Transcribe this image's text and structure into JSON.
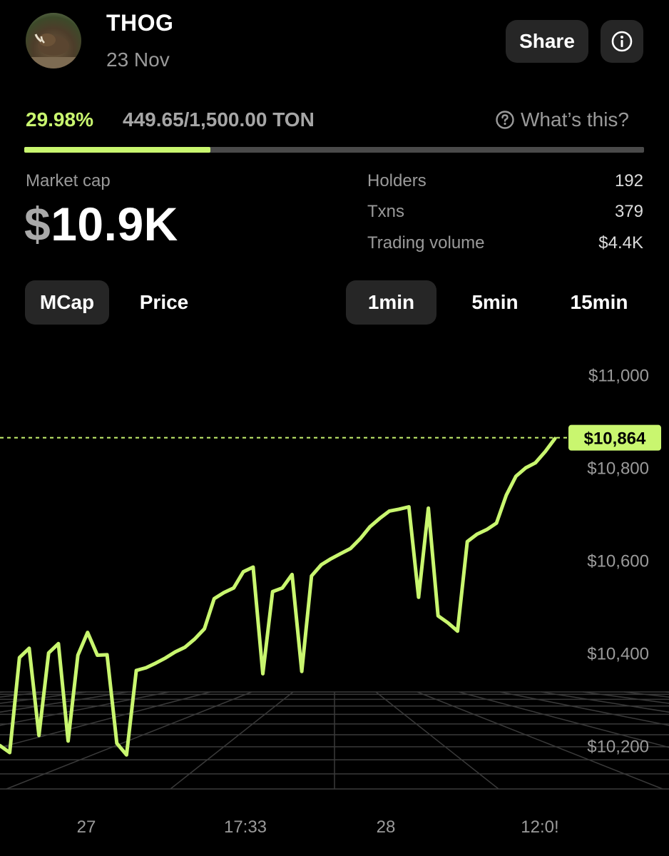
{
  "header": {
    "token_name": "THOG",
    "date": "23 Nov",
    "share_label": "Share",
    "info_icon": "info-icon",
    "avatar": "warthog-avatar"
  },
  "progress": {
    "percent_label": "29.98%",
    "amount_label": "449.65/1,500.00 TON",
    "fraction": 0.2998,
    "whats_this_label": "What’s this?",
    "help_icon": "question-circle-icon"
  },
  "stats": {
    "market_cap_label": "Market cap",
    "market_cap_currency": "$",
    "market_cap_value": "10.9K",
    "rows": [
      {
        "label": "Holders",
        "value": "192"
      },
      {
        "label": "Txns",
        "value": "379"
      },
      {
        "label": "Trading volume",
        "value": "$4.4K"
      }
    ]
  },
  "toggles": {
    "metric": [
      "MCap",
      "Price"
    ],
    "metric_selected": "MCap",
    "interval": [
      "1min",
      "5min",
      "15min"
    ],
    "interval_selected": "1min"
  },
  "colors": {
    "accent": "#c9f66f",
    "background": "#000000",
    "button_bg": "#262626",
    "muted_text": "#9a9a9a"
  },
  "chart_data": {
    "type": "line",
    "y_ticks": [
      "$11,000",
      "$10,800",
      "$10,600",
      "$10,400",
      "$10,200"
    ],
    "y_tick_values": [
      11000,
      10800,
      10600,
      10400,
      10200
    ],
    "ylim": [
      10085,
      11085
    ],
    "x_ticks": [
      "27",
      "17:33",
      "28",
      "12:0!"
    ],
    "current_value": 10864,
    "current_label": "$10,864",
    "series": [
      {
        "values": [
          10200,
          10185,
          10390,
          10410,
          10222,
          10400,
          10420,
          10210,
          10395,
          10444,
          10395,
          10396,
          10205,
          10180,
          10362,
          10368,
          10378,
          10389,
          10402,
          10412,
          10430,
          10452,
          10517,
          10530,
          10540,
          10575,
          10585,
          10355,
          10532,
          10540,
          10569,
          10360,
          10566,
          10590,
          10603,
          10614,
          10625,
          10646,
          10672,
          10690,
          10706,
          10710,
          10715,
          10520,
          10712,
          10480,
          10465,
          10447,
          10640,
          10656,
          10666,
          10680,
          10740,
          10781,
          10799,
          10810,
          10834,
          10862
        ]
      }
    ]
  }
}
